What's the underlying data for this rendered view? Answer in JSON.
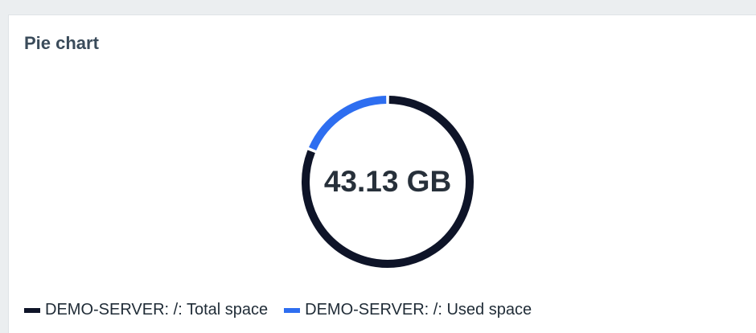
{
  "widget": {
    "title": "Pie chart"
  },
  "chart_data": {
    "type": "pie",
    "style": "donut",
    "center_label": "43.13 GB",
    "series": [
      {
        "name": "DEMO-SERVER: /: Total space",
        "value": 100,
        "color": "#0e1428"
      },
      {
        "name": "DEMO-SERVER: /: Used space",
        "value": 23,
        "color": "#2e6ef0"
      }
    ]
  },
  "legend": [
    {
      "label": "DEMO-SERVER: /: Total space",
      "color": "#0e1428"
    },
    {
      "label": "DEMO-SERVER: /: Used space",
      "color": "#2e6ef0"
    }
  ]
}
